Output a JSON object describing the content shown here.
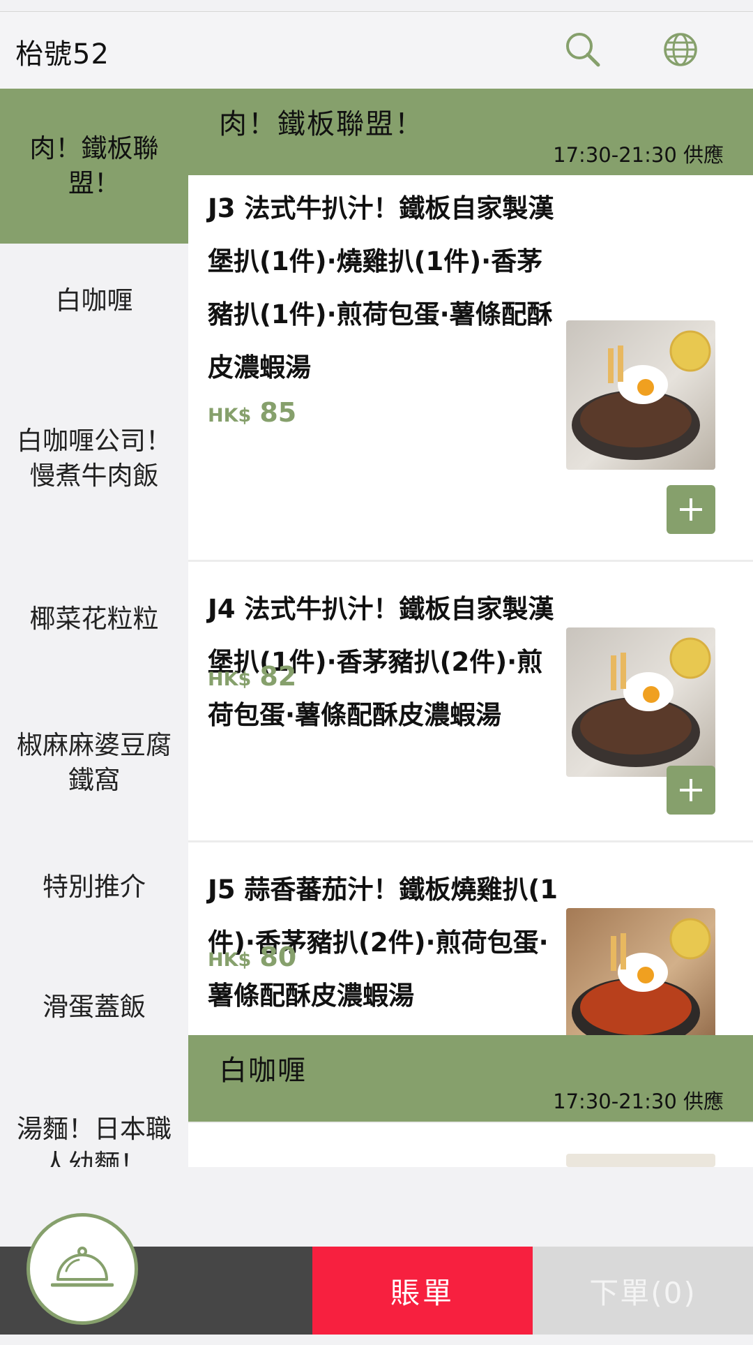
{
  "header": {
    "table_label": "枱號52",
    "search_icon": "search-icon",
    "language_icon": "globe-icon"
  },
  "sidebar": {
    "items": [
      {
        "label": "肉！鐵板聯盟！",
        "active": true
      },
      {
        "label": "白咖喱"
      },
      {
        "label": "白咖喱公司！慢煮牛肉飯"
      },
      {
        "label": "椰菜花粒粒"
      },
      {
        "label": "椒麻麻婆豆腐鐵窩"
      },
      {
        "label": "特別推介"
      },
      {
        "label": "滑蛋蓋飯"
      },
      {
        "label": "湯麵！日本職人幼麵！"
      }
    ]
  },
  "sections": [
    {
      "title": "肉！鐵板聯盟！",
      "time": "17:30-21:30 供應",
      "items": [
        {
          "name": "J3 法式牛扒汁！鐵板自家製漢堡扒(1件)·燒雞扒(1件)·香茅豬扒(1件)·煎荷包蛋·薯條配酥皮濃蝦湯",
          "currency": "HK$",
          "price": "85"
        },
        {
          "name": "J4 法式牛扒汁！鐵板自家製漢堡扒(1件)·香茅豬扒(2件)·煎荷包蛋·薯條配酥皮濃蝦湯",
          "currency": "HK$",
          "price": "82"
        },
        {
          "name": "J5 蒜香蕃茄汁！鐵板燒雞扒(1件)·香茅豬扒(2件)·煎荷包蛋·薯條配酥皮濃蝦湯",
          "currency": "HK$",
          "price": "80"
        }
      ]
    },
    {
      "title": "白咖喱",
      "time": "17:30-21:30 供應",
      "items": []
    }
  ],
  "bottom_bar": {
    "bill_label": "賬單",
    "order_label": "下單(0)",
    "cloche_icon": "cloche-icon"
  },
  "colors": {
    "accent": "#86a06c",
    "bill": "#f7203f",
    "dark": "#464646"
  }
}
